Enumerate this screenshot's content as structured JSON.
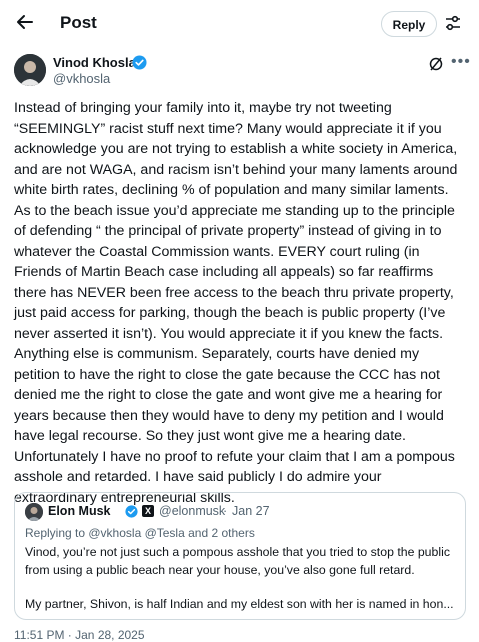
{
  "header": {
    "title": "Post",
    "reply_label": "Reply"
  },
  "author": {
    "name": "Vinod Khosla",
    "handle": "@vkhosla"
  },
  "tweet": {
    "paragraphs": [
      "Instead of bringing your family into it, maybe try not tweeting “SEEMINGLY” racist stuff next time? Many would appreciate it if you acknowledge you are not trying to establish a white society in America, and are not WAGA,  and racism isn’t behind your many laments around white birth rates, declining % of population and many similar laments.",
      "As to the beach issue you’d appreciate me standing up  to the principle of defending “ the principal of private property” instead of giving in to whatever the Coastal Commission wants. EVERY court ruling (in Friends of Martin Beach case including all appeals) so far reaffirms  there has NEVER been free access to the beach thru private property, just paid access for parking, though the beach is public property (I’ve never asserted it isn’t). You would appreciate it if you knew the facts. Anything else is communism. Separately, courts have denied my petition to have the right to close the gate because the CCC has not denied me the right to close the gate and wont give me a hearing for years because then they would have to deny my petition and I would have legal recourse.  So they just wont give me a hearing date.",
      "Unfortunately I have no  proof to refute your claim that I am a pompous asshole and retarded. I have said publicly I do admire your extraordinary entrepreneurial skills."
    ]
  },
  "quote": {
    "name": "Elon Musk",
    "handle": "@elonmusk",
    "separator": "·",
    "date": "Jan 27",
    "replying_to": "Replying to @vkhosla @Tesla and 2 others",
    "paragraph1": "Vinod, you’re not just such a pompous asshole that you tried to stop the public from using a public beach near your house, you’ve also gone full retard.",
    "paragraph2": "My partner, Shivon, is half Indian and my eldest son with her is named in hon..."
  },
  "footer": {
    "timestamp": "11:51 PM · Jan 28, 2025"
  },
  "colors": {
    "verified_blue": "#1d9bf0",
    "secondary_text": "#536471",
    "border": "#cfd9de"
  }
}
